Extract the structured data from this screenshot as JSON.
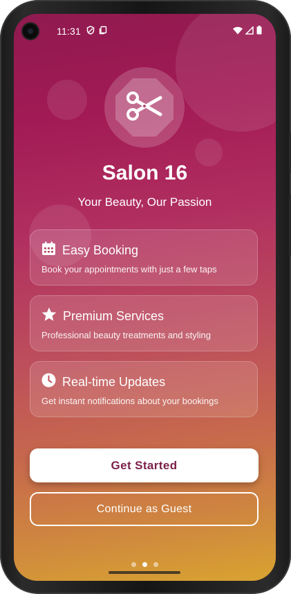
{
  "status_bar": {
    "time": "11:31",
    "left_icons": [
      "shield-icon",
      "clipboard-icon"
    ],
    "right_icons": [
      "wifi-icon",
      "signal-icon",
      "battery-icon"
    ]
  },
  "logo": {
    "icon": "scissors-icon"
  },
  "app": {
    "title": "Salon 16",
    "tagline": "Your Beauty, Our Passion"
  },
  "features": [
    {
      "icon": "calendar-icon",
      "title": "Easy Booking",
      "description": "Book your appointments with just a few taps"
    },
    {
      "icon": "star-icon",
      "title": "Premium Services",
      "description": "Professional beauty treatments and styling"
    },
    {
      "icon": "clock-icon",
      "title": "Real-time Updates",
      "description": "Get instant notifications about your bookings"
    }
  ],
  "actions": {
    "primary_label": "Get Started",
    "secondary_label": "Continue as Guest"
  },
  "pager": {
    "total": 3,
    "active_index": 1
  },
  "colors": {
    "gradient_top": "#8f1a4f",
    "gradient_bottom": "#d9a330",
    "primary_button_text": "#7a1f49"
  }
}
